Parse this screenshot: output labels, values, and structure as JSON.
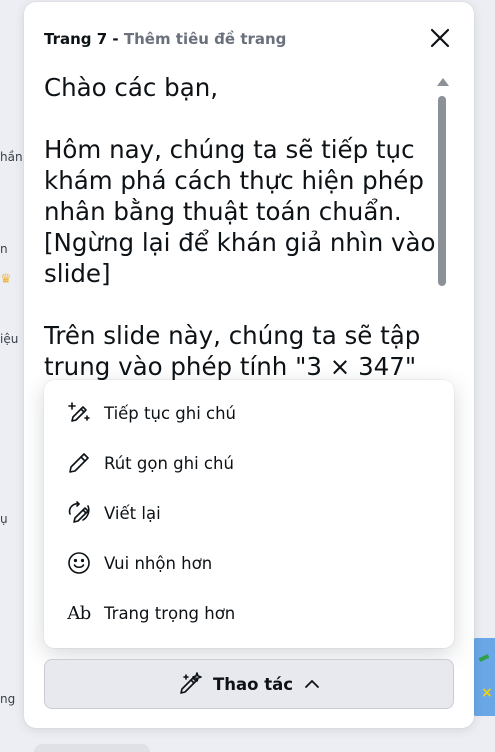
{
  "background": {
    "fragments": [
      "hần",
      "n",
      "iệu",
      "ụ",
      "ng"
    ]
  },
  "panel": {
    "page_label": "Trang 7",
    "separator": " - ",
    "add_title": "Thêm tiêu đề trang",
    "notes": [
      "Chào các bạn,",
      "Hôm nay, chúng ta sẽ tiếp tục khám phá cách thực hiện phép nhân bằng thuật toán chuẩn. [Ngừng lại để khán giả nhìn vào slide]",
      "Trên slide này, chúng ta sẽ tập trung vào phép tính \"3 × 347\""
    ]
  },
  "menu": {
    "items": [
      {
        "label": "Tiếp tục ghi chú",
        "icon": "magic-pen-plus-icon"
      },
      {
        "label": "Rút gọn ghi chú",
        "icon": "pencil-icon"
      },
      {
        "label": "Viết lại",
        "icon": "rewrite-pen-icon"
      },
      {
        "label": "Vui nhộn hơn",
        "icon": "smiley-icon"
      },
      {
        "label": "Trang trọng hơn",
        "icon": "ab-text-icon",
        "icon_text": "Ab"
      }
    ]
  },
  "action_button": {
    "label": "Thao tác",
    "icon": "magic-wand-icon"
  }
}
